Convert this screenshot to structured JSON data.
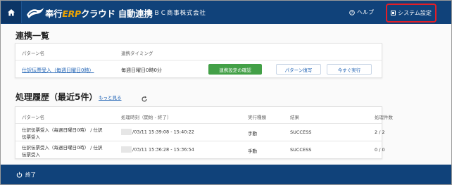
{
  "header": {
    "logo_brand": "奉行",
    "logo_erp": "ERP",
    "logo_rest": "クラウド",
    "logo_suffix": "自動連携",
    "company": "ＯＢＣ商事株式会社",
    "help_label": "ヘルプ",
    "system_settings_label": "システム設定"
  },
  "integration_list": {
    "title": "連携一覧",
    "columns": [
      "パターン名",
      "連携タイミング"
    ],
    "row": {
      "pattern_name": "仕訳伝票受入（毎週日曜日0時）",
      "timing": "毎週日曜日0時0分",
      "confirm_button": "連携設定の確認",
      "restore_button": "パターン復写",
      "run_now_button": "今すぐ実行"
    }
  },
  "history": {
    "title": "処理履歴（最近5件）",
    "see_more": "もっと見る",
    "columns": [
      "パターン名",
      "処理時刻（開始 - 終了）",
      "実行種類",
      "結果",
      "処理件数"
    ],
    "rows": [
      {
        "pattern_line1": "仕訳伝票受入（毎週日曜日0時） / 仕訳",
        "pattern_line2": "伝票受入",
        "time": "/03/11 15:39:08 - 15:40:22",
        "type": "手動",
        "result": "SUCCESS",
        "count": "2 / 2"
      },
      {
        "pattern_line1": "仕訳伝票受入（毎週日曜日0時） / 仕訳",
        "pattern_line2": "伝票受入",
        "time": "/03/11 15:36:28 - 15:36:54",
        "type": "手動",
        "result": "SUCCESS",
        "count": "0 / 0"
      }
    ]
  },
  "footer": {
    "exit_label": "終了"
  }
}
